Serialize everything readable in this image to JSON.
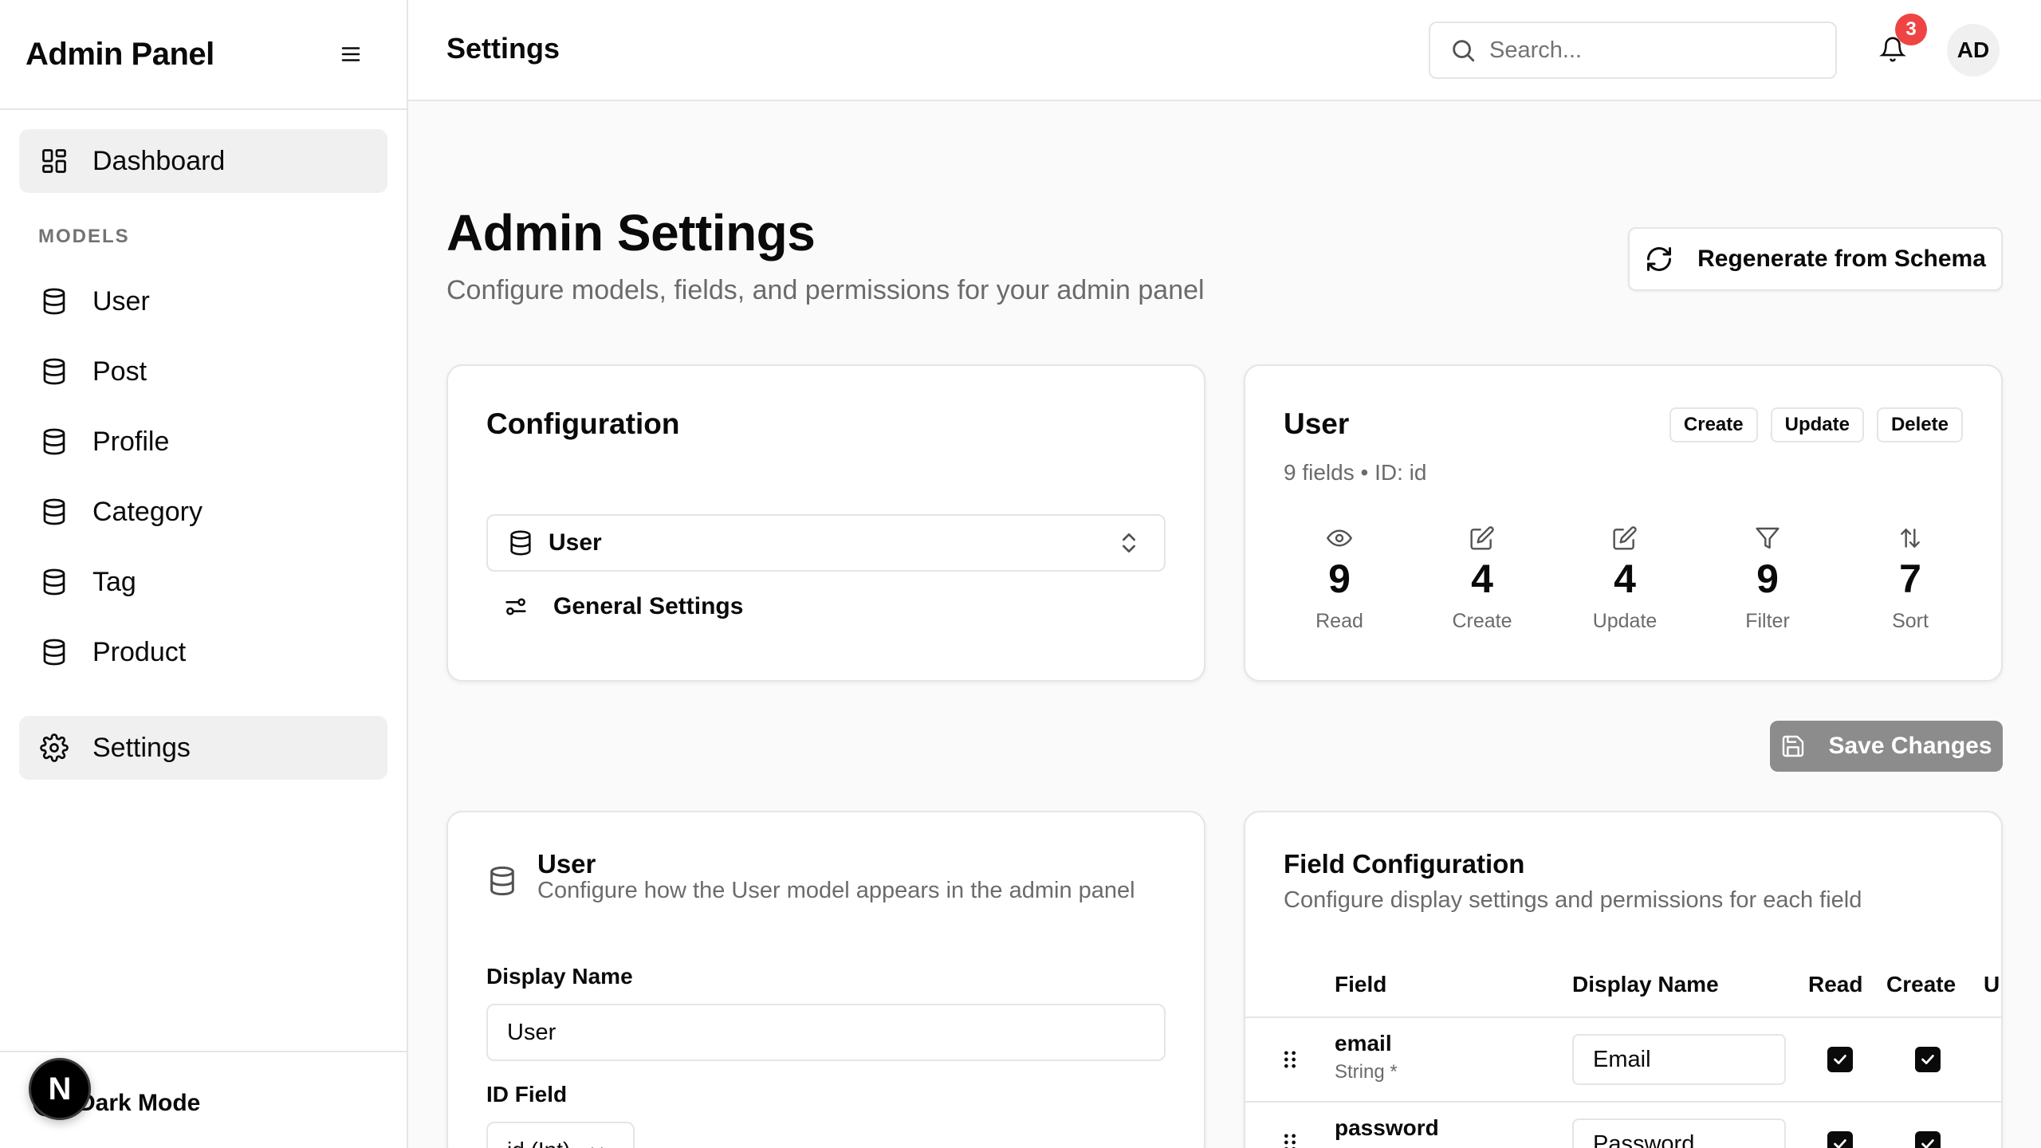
{
  "sidebar": {
    "brand": "Admin Panel",
    "dashboard_label": "Dashboard",
    "models_section": "MODELS",
    "models": [
      {
        "label": "User"
      },
      {
        "label": "Post"
      },
      {
        "label": "Profile"
      },
      {
        "label": "Category"
      },
      {
        "label": "Tag"
      },
      {
        "label": "Product"
      }
    ],
    "settings_label": "Settings",
    "dark_mode_label": "Dark Mode",
    "next_badge": "N"
  },
  "topbar": {
    "title": "Settings",
    "search_placeholder": "Search...",
    "notification_count": "3",
    "avatar_initials": "AD"
  },
  "page": {
    "title": "Admin Settings",
    "subtitle": "Configure models, fields, and permissions for your admin panel",
    "regenerate_label": "Regenerate from Schema",
    "save_label": "Save Changes"
  },
  "config_card": {
    "title": "Configuration",
    "selected_model": "User",
    "general_settings_label": "General Settings"
  },
  "user_card": {
    "title": "User",
    "meta": "9 fields • ID: id",
    "actions": [
      "Create",
      "Update",
      "Delete"
    ],
    "stats": [
      {
        "icon": "eye-icon",
        "value": "9",
        "label": "Read"
      },
      {
        "icon": "edit-icon",
        "value": "4",
        "label": "Create"
      },
      {
        "icon": "edit-icon",
        "value": "4",
        "label": "Update"
      },
      {
        "icon": "filter-icon",
        "value": "9",
        "label": "Filter"
      },
      {
        "icon": "sort-icon",
        "value": "7",
        "label": "Sort"
      }
    ]
  },
  "model_card": {
    "title": "User",
    "description": "Configure how the User model appears in the admin panel",
    "display_name_label": "Display Name",
    "display_name_value": "User",
    "id_field_label": "ID Field",
    "id_field_value": "id (Int)"
  },
  "field_card": {
    "title": "Field Configuration",
    "description": "Configure display settings and permissions for each field",
    "columns": [
      "Field",
      "Display Name",
      "Read",
      "Create",
      "U"
    ],
    "rows": [
      {
        "name": "email",
        "type": "String *",
        "display": "Email",
        "read": true,
        "create": true
      },
      {
        "name": "password",
        "type": "",
        "display": "Password",
        "read": true,
        "create": true
      }
    ]
  },
  "colors": {
    "accent": "#0a0a0a",
    "badge": "#ef4444",
    "save_button": "#8c8c8c",
    "border": "#e5e5e5",
    "muted_text": "#6b6b6b"
  }
}
